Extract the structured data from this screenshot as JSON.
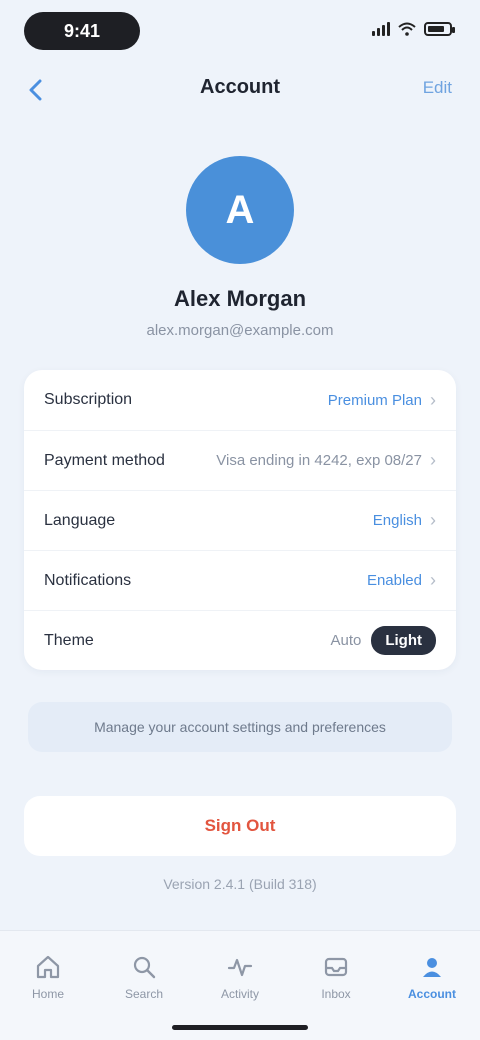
{
  "status_bar": {
    "time": "9:41"
  },
  "nav": {
    "title": "Account",
    "action": "Edit"
  },
  "profile": {
    "initial": "A",
    "name": "Alex Morgan",
    "email": "alex.morgan@example.com"
  },
  "rows": [
    {
      "label": "Subscription",
      "value": "Premium Plan"
    },
    {
      "label": "Payment method",
      "value": "Visa ending in 4242, exp 08/27"
    },
    {
      "label": "Language",
      "value": "English"
    },
    {
      "label": "Notifications",
      "value": "Enabled"
    },
    {
      "label": "Theme",
      "options": [
        "Auto",
        "Light"
      ],
      "selected": "Light"
    }
  ],
  "info_text": "Manage your account settings and preferences",
  "sign_out_label": "Sign Out",
  "version": "Version 2.4.1 (Build 318)",
  "tabs": [
    {
      "label": "Home",
      "icon": "home-icon"
    },
    {
      "label": "Search",
      "icon": "search-icon"
    },
    {
      "label": "Activity",
      "icon": "activity-icon"
    },
    {
      "label": "Inbox",
      "icon": "inbox-icon"
    },
    {
      "label": "Account",
      "icon": "person-icon",
      "active": true
    }
  ],
  "colors": {
    "background": "#EEF3FA",
    "accent": "#4A90D9",
    "danger": "#E2553F"
  }
}
